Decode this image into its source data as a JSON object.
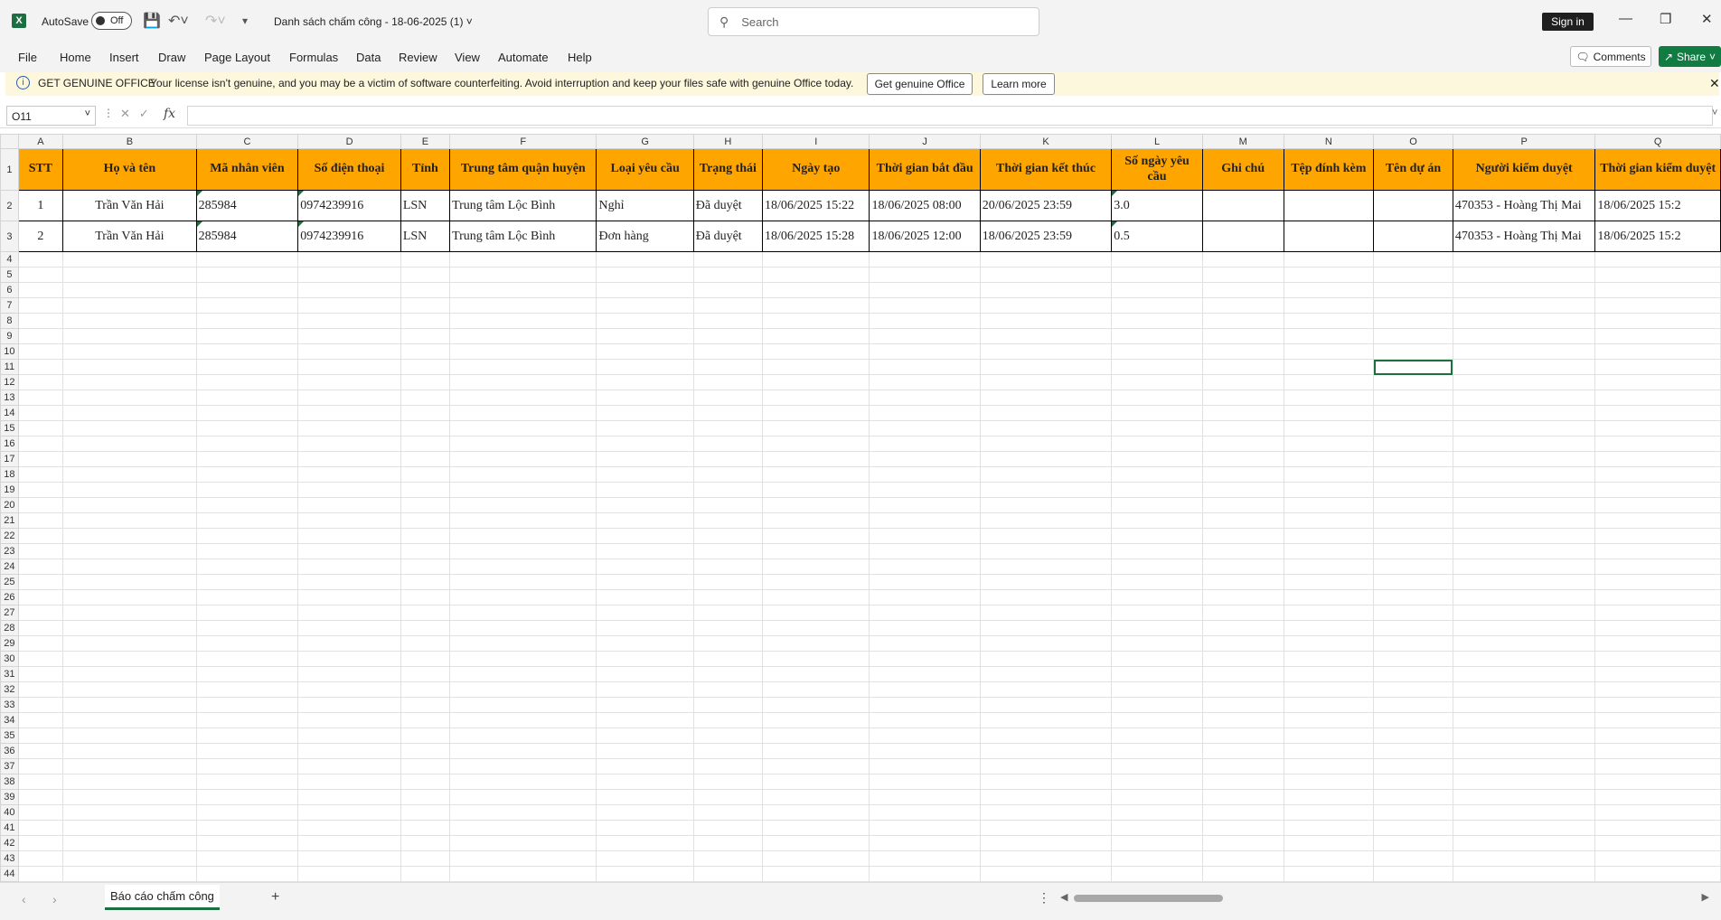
{
  "titlebar": {
    "app_icon": "excel-logo-icon",
    "autosave_label": "AutoSave",
    "autosave_state": "Off",
    "document_title": "Danh sách chấm công - 18-06-2025 (1)",
    "search_placeholder": "Search",
    "sign_in": "Sign in"
  },
  "menu": {
    "items": [
      "File",
      "Home",
      "Insert",
      "Draw",
      "Page Layout",
      "Formulas",
      "Data",
      "Review",
      "View",
      "Automate",
      "Help"
    ],
    "comments": "Comments",
    "share": "Share"
  },
  "notice": {
    "heading": "GET GENUINE OFFICE",
    "message": "Your license isn't genuine, and you may be a victim of software counterfeiting. Avoid interruption and keep your files safe with genuine Office today.",
    "primary_button": "Get genuine Office",
    "secondary_button": "Learn more"
  },
  "formula_bar": {
    "name_box": "O11",
    "fx": "fx",
    "value": ""
  },
  "columns": [
    "A",
    "B",
    "C",
    "D",
    "E",
    "F",
    "G",
    "H",
    "I",
    "J",
    "K",
    "L",
    "M",
    "N",
    "O",
    "P",
    "Q"
  ],
  "selected_column": "O",
  "selected_row": 11,
  "header_row": [
    "STT",
    "Họ và tên",
    "Mã nhân viên",
    "Số điện thoại",
    "Tỉnh",
    "Trung tâm quận huyện",
    "Loại yêu cầu",
    "Trạng thái",
    "Ngày tạo",
    "Thời gian bắt đầu",
    "Thời gian kết thúc",
    "Số ngày yêu cầu",
    "Ghi chú",
    "Tệp đính kèm",
    "Tên dự án",
    "Người kiểm duyệt",
    "Thời gian kiểm duyệt"
  ],
  "rows": [
    [
      "1",
      "Trần Văn Hải",
      "285984",
      "0974239916",
      "LSN",
      "Trung tâm Lộc Bình",
      "Nghỉ",
      "Đã duyệt",
      "18/06/2025 15:22",
      "18/06/2025 08:00",
      "20/06/2025 23:59",
      "3.0",
      "",
      "",
      "",
      "470353 - Hoàng Thị Mai",
      "18/06/2025 15:2"
    ],
    [
      "2",
      "Trần Văn Hải",
      "285984",
      "0974239916",
      "LSN",
      "Trung tâm Lộc Bình",
      "Đơn hàng",
      "Đã duyệt",
      "18/06/2025 15:28",
      "18/06/2025 12:00",
      "18/06/2025 23:59",
      "0.5",
      "",
      "",
      "",
      "470353 - Hoàng Thị Mai",
      "18/06/2025 15:2"
    ]
  ],
  "sheet_tab": "Báo cáo chấm công",
  "colors": {
    "accent": "#1d6f42",
    "header_fill": "#ffa500",
    "notice_bg": "#fdf7dd"
  }
}
